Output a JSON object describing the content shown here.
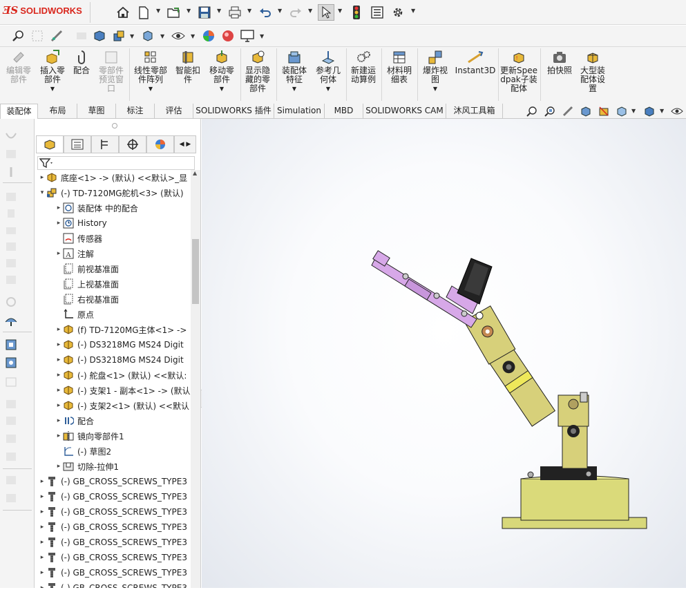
{
  "app": {
    "logo_ds": "ƎS",
    "logo_text": "SOLIDWORKS"
  },
  "ribbon": {
    "buttons": [
      {
        "label": "编辑零部件",
        "icon": "edit-component-icon",
        "disabled": true
      },
      {
        "label": "插入零部件",
        "icon": "insert-component-icon",
        "disabled": false
      },
      {
        "label": "配合",
        "icon": "mate-icon",
        "disabled": false
      },
      {
        "label": "零部件预览窗口",
        "icon": "component-preview-icon",
        "disabled": true
      },
      {
        "label": "线性零部件阵列",
        "icon": "linear-pattern-icon",
        "disabled": false
      },
      {
        "label": "智能扣件",
        "icon": "smart-fastener-icon",
        "disabled": false
      },
      {
        "label": "移动零部件",
        "icon": "move-component-icon",
        "disabled": false
      },
      {
        "label": "显示隐藏的零部件",
        "icon": "show-hidden-icon",
        "disabled": false
      },
      {
        "label": "装配体特征",
        "icon": "assembly-feature-icon",
        "disabled": false
      },
      {
        "label": "参考几何体",
        "icon": "reference-geometry-icon",
        "disabled": false
      },
      {
        "label": "新建运动算例",
        "icon": "motion-study-icon",
        "disabled": false
      },
      {
        "label": "材料明细表",
        "icon": "bom-icon",
        "disabled": false
      },
      {
        "label": "爆炸视图",
        "icon": "exploded-view-icon",
        "disabled": false
      },
      {
        "label": "Instant3D",
        "icon": "instant3d-icon",
        "disabled": false
      },
      {
        "label": "更新Speedpak子装配体",
        "icon": "speedpak-icon",
        "disabled": false
      },
      {
        "label": "拍快照",
        "icon": "snapshot-icon",
        "disabled": false
      },
      {
        "label": "大型装配体设置",
        "icon": "large-assembly-icon",
        "disabled": false
      }
    ]
  },
  "tabs": [
    "装配体",
    "布局",
    "草图",
    "标注",
    "评估",
    "SOLIDWORKS 插件",
    "Simulation",
    "MBD",
    "SOLIDWORKS CAM",
    "沐风工具箱"
  ],
  "tree": [
    {
      "text": "底座<1> -> (默认) <<默认>_显",
      "icon": "part-icon"
    },
    {
      "text": "(-) TD-7120MG舵机<3> (默认)",
      "icon": "subassembly-icon"
    },
    {
      "text": "装配体 中的配合",
      "icon": "mates-folder-icon"
    },
    {
      "text": "History",
      "icon": "history-icon"
    },
    {
      "text": "传感器",
      "icon": "sensor-icon"
    },
    {
      "text": "注解",
      "icon": "annotation-icon"
    },
    {
      "text": "前视基准面",
      "icon": "plane-icon"
    },
    {
      "text": "上视基准面",
      "icon": "plane-icon"
    },
    {
      "text": "右视基准面",
      "icon": "plane-icon"
    },
    {
      "text": "原点",
      "icon": "origin-icon"
    },
    {
      "text": "(f) TD-7120MG主体<1> ->",
      "icon": "part-icon"
    },
    {
      "text": "(-) DS3218MG MS24 Digit",
      "icon": "part-icon"
    },
    {
      "text": "(-) DS3218MG MS24 Digit",
      "icon": "part-icon"
    },
    {
      "text": "(-) 舵盘<1> (默认) <<默认:",
      "icon": "part-icon"
    },
    {
      "text": "(-) 支架1 - 副本<1> -> (默认",
      "icon": "part-icon"
    },
    {
      "text": "(-) 支架2<1> (默认) <<默认",
      "icon": "part-icon"
    },
    {
      "text": "配合",
      "icon": "mates-icon"
    },
    {
      "text": "镜向零部件1",
      "icon": "mirror-component-icon"
    },
    {
      "text": "(-) 草图2",
      "icon": "sketch-icon"
    },
    {
      "text": "切除-拉伸1",
      "icon": "cut-extrude-icon"
    },
    {
      "text": "(-) GB_CROSS_SCREWS_TYPE3",
      "icon": "screw-icon"
    },
    {
      "text": "(-) GB_CROSS_SCREWS_TYPE3",
      "icon": "screw-icon"
    },
    {
      "text": "(-) GB_CROSS_SCREWS_TYPE3",
      "icon": "screw-icon"
    },
    {
      "text": "(-) GB_CROSS_SCREWS_TYPE3",
      "icon": "screw-icon"
    },
    {
      "text": "(-) GB_CROSS_SCREWS_TYPE3",
      "icon": "screw-icon"
    },
    {
      "text": "(-) GB_CROSS_SCREWS_TYPE3",
      "icon": "screw-icon"
    },
    {
      "text": "(-) GB_CROSS_SCREWS_TYPE3",
      "icon": "screw-icon"
    },
    {
      "text": "(-) GB_CROSS_SCREWS_TYPE3",
      "icon": "screw-icon"
    }
  ],
  "colors": {
    "accent": "#d9261c",
    "part": "#e8b93a",
    "arm": "#d7d07a",
    "servo": "#d7a8e8",
    "base": "#dada7a"
  }
}
